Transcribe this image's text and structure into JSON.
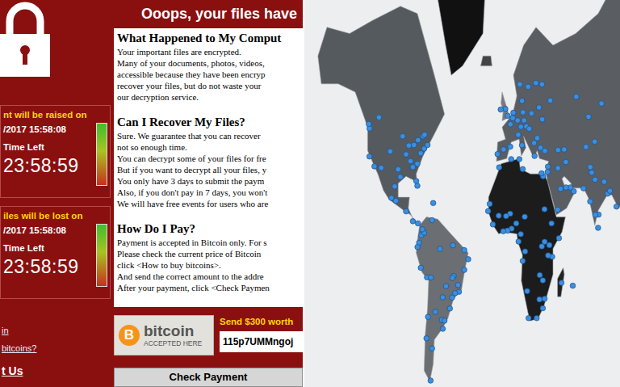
{
  "ransom_window": {
    "title": "Ooops, your files have",
    "timers": [
      {
        "label": "nt will be raised on",
        "date": "/2017 15:58:08",
        "time_left_label": "Time Left",
        "time": "23:58:59",
        "level": 1
      },
      {
        "label": "iles will be lost on",
        "date": "/2017 15:58:08",
        "time_left_label": "Time Left",
        "time": "23:58:59",
        "level": 1
      }
    ],
    "sections": [
      {
        "heading": "What Happened to My Comput",
        "lines": [
          "Your important files are encrypted.",
          "Many of your documents, photos, videos,",
          "accessible because they have been encryp",
          "recover your files, but do not waste your",
          "our decryption service."
        ]
      },
      {
        "heading": "Can I Recover My Files?",
        "lines": [
          "Sure. We guarantee that you can recover",
          "not so enough time.",
          "You can decrypt some of your files for fre",
          "But if you want to decrypt all your files, y",
          "You only have 3 days to submit the paym",
          "Also, if you don't pay in 7 days, you won't",
          "We will have free events for users who are"
        ]
      },
      {
        "heading": "How Do I Pay?",
        "lines": [
          "Payment is accepted in Bitcoin only. For s",
          "Please check the current price of Bitcoin",
          "click <How to buy bitcoins>.",
          "And send the correct amount to the addre",
          "After your payment, click <Check Paymen"
        ]
      }
    ],
    "links": [
      {
        "text": "in",
        "kind": "small"
      },
      {
        "text": "bitcoins?",
        "kind": "small"
      },
      {
        "text": "t Us",
        "kind": "large"
      }
    ],
    "bitcoin_badge": {
      "symbol": "B",
      "name": "bitcoin",
      "caption": "ACCEPTED HERE"
    },
    "send_label": "Send $300 worth",
    "address": "115p7UMMngoj",
    "check_button": "Check Payment"
  },
  "map": {
    "points": [
      [
        -74,
        40.7
      ],
      [
        -71,
        42
      ],
      [
        -77,
        39
      ],
      [
        -80,
        35
      ],
      [
        -84,
        33.7
      ],
      [
        -81,
        28
      ],
      [
        -87.6,
        41.8
      ],
      [
        -83,
        42
      ],
      [
        -90,
        38.6
      ],
      [
        -95,
        29.7
      ],
      [
        -97,
        32.8
      ],
      [
        -104,
        39.7
      ],
      [
        -112,
        33.4
      ],
      [
        -118,
        34
      ],
      [
        -122.4,
        37.8
      ],
      [
        -122.3,
        47.6
      ],
      [
        -93,
        45
      ],
      [
        -86,
        36
      ],
      [
        -80,
        26
      ],
      [
        -75,
        45
      ],
      [
        -79.4,
        43.7
      ],
      [
        -73.6,
        45.5
      ],
      [
        -114,
        51
      ],
      [
        -123,
        49
      ],
      [
        -99,
        19.4
      ],
      [
        -103,
        20.7
      ],
      [
        -100,
        25.7
      ],
      [
        -90,
        14.6
      ],
      [
        -84,
        10
      ],
      [
        -79.5,
        9
      ],
      [
        -66,
        18.4
      ],
      [
        -76.5,
        3.4
      ],
      [
        -74,
        4.6
      ],
      [
        -75.6,
        6.2
      ],
      [
        -67,
        10.5
      ],
      [
        -78.5,
        -0.2
      ],
      [
        -79.9,
        -2.2
      ],
      [
        -77,
        -12
      ],
      [
        -71.5,
        -16.4
      ],
      [
        -68,
        -16.5
      ],
      [
        -70.6,
        -33.4
      ],
      [
        -64,
        -31.4
      ],
      [
        -58.4,
        -34.6
      ],
      [
        -57.5,
        -38
      ],
      [
        -56,
        -34.9
      ],
      [
        -57.6,
        -25.3
      ],
      [
        -60,
        -3.1
      ],
      [
        -48.5,
        -1.4
      ],
      [
        -38.5,
        -3.7
      ],
      [
        -35,
        -8
      ],
      [
        -38.5,
        -13
      ],
      [
        -47.9,
        -15.8
      ],
      [
        -43.2,
        -22.9
      ],
      [
        -46.6,
        -23.5
      ],
      [
        -49.3,
        -25.4
      ],
      [
        -51.2,
        -30
      ],
      [
        -44,
        -19.9
      ],
      [
        -49,
        -16.7
      ],
      [
        -54.6,
        -20.4
      ],
      [
        -67,
        -45
      ],
      [
        -68.3,
        -54.8
      ],
      [
        -72,
        -41.5
      ],
      [
        -0.1,
        51.5
      ],
      [
        -2.2,
        53.5
      ],
      [
        -6.3,
        53.3
      ],
      [
        2.35,
        48.9
      ],
      [
        4.9,
        52.4
      ],
      [
        4.4,
        50.8
      ],
      [
        8.7,
        50.1
      ],
      [
        13.4,
        52.5
      ],
      [
        11.6,
        48.1
      ],
      [
        16.4,
        48.2
      ],
      [
        14.4,
        50.1
      ],
      [
        21,
        52.2
      ],
      [
        19,
        47.5
      ],
      [
        26.1,
        44.4
      ],
      [
        23.3,
        42.7
      ],
      [
        23.7,
        38
      ],
      [
        12.5,
        41.9
      ],
      [
        9.2,
        45.5
      ],
      [
        -3.7,
        40.4
      ],
      [
        2.2,
        41.4
      ],
      [
        -9.1,
        38.7
      ],
      [
        10.7,
        59.9
      ],
      [
        18,
        59.3
      ],
      [
        24.9,
        60.2
      ],
      [
        12.6,
        55.7
      ],
      [
        30.5,
        50.4
      ],
      [
        37.6,
        55.8
      ],
      [
        30.3,
        59.9
      ],
      [
        27.6,
        53.9
      ],
      [
        44.5,
        40.2
      ],
      [
        49.9,
        40.4
      ],
      [
        29,
        41
      ],
      [
        32.9,
        39.9
      ],
      [
        35.2,
        31.8
      ],
      [
        35.5,
        33.9
      ],
      [
        44.4,
        33.3
      ],
      [
        51.4,
        35.7
      ],
      [
        46.7,
        24.7
      ],
      [
        55.3,
        25.3
      ],
      [
        51.5,
        25.3
      ],
      [
        58.4,
        23.6
      ],
      [
        44.2,
        15.4
      ],
      [
        69.2,
        41.3
      ],
      [
        71.4,
        51.2
      ],
      [
        76.9,
        43.2
      ],
      [
        60.6,
        56.8
      ],
      [
        82.9,
        55
      ],
      [
        67,
        24.9
      ],
      [
        74.3,
        31.5
      ],
      [
        73,
        33.7
      ],
      [
        72.9,
        19.1
      ],
      [
        77.2,
        28.6
      ],
      [
        80.3,
        13.1
      ],
      [
        77.6,
        13
      ],
      [
        88.4,
        22.6
      ],
      [
        90.4,
        23.8
      ],
      [
        85.3,
        27.7
      ],
      [
        79.9,
        6.9
      ],
      [
        96.2,
        16.8
      ],
      [
        -7.6,
        33.6
      ],
      [
        3,
        36.8
      ],
      [
        10.2,
        36.8
      ],
      [
        13.2,
        32.9
      ],
      [
        31.2,
        30
      ],
      [
        29.9,
        31.2
      ],
      [
        32.5,
        15.6
      ],
      [
        38.7,
        9
      ],
      [
        45.3,
        2
      ],
      [
        36.8,
        -1.3
      ],
      [
        39.3,
        -6.8
      ],
      [
        32.6,
        0.3
      ],
      [
        30.1,
        -1.9
      ],
      [
        28.3,
        -15.4
      ],
      [
        31,
        -17.8
      ],
      [
        32.6,
        -25.9
      ],
      [
        28,
        -26.2
      ],
      [
        31,
        -29.9
      ],
      [
        18.4,
        -33.9
      ],
      [
        25.6,
        -33.9
      ],
      [
        17.1,
        -22.6
      ],
      [
        13.2,
        -8.8
      ],
      [
        15.3,
        -4.3
      ],
      [
        9.5,
        0.4
      ],
      [
        11.5,
        3.9
      ],
      [
        3.4,
        6.5
      ],
      [
        7.5,
        9
      ],
      [
        -0.2,
        5.6
      ],
      [
        -4,
        5.3
      ],
      [
        -13.2,
        8.5
      ],
      [
        -17.4,
        14.7
      ],
      [
        -8,
        12.6
      ],
      [
        2.1,
        13.5
      ],
      [
        15,
        12.1
      ],
      [
        47.5,
        -18.9
      ],
      [
        57.5,
        -20.2
      ],
      [
        -16,
        18
      ],
      [
        -1.5,
        12.4
      ],
      [
        35.7,
        -6.2
      ]
    ]
  }
}
